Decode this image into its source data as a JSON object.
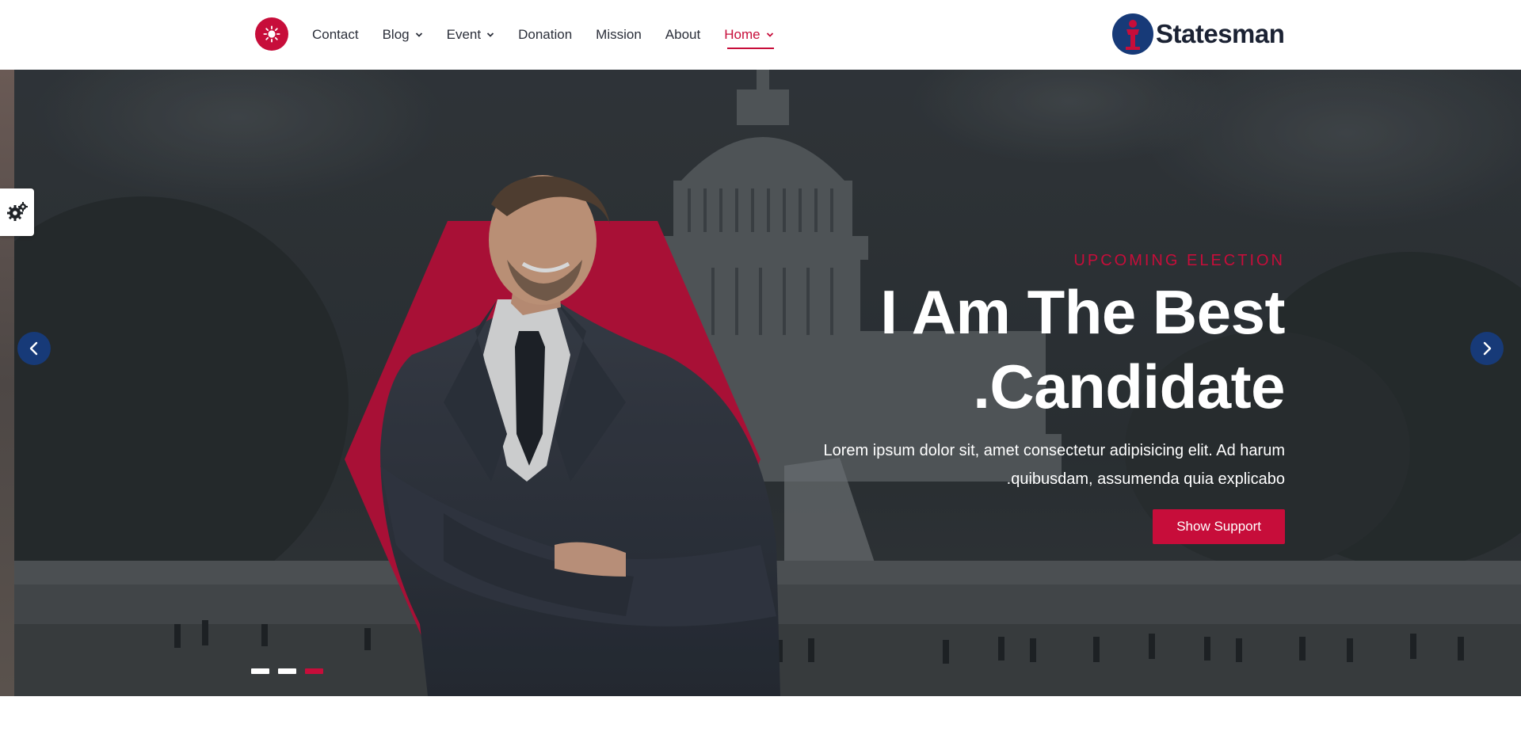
{
  "header": {
    "menu_badge_icon": "sun-burst-icon",
    "nav": [
      {
        "label": "Contact",
        "has_dropdown": false
      },
      {
        "label": "Blog",
        "has_dropdown": true
      },
      {
        "label": "Event",
        "has_dropdown": true
      },
      {
        "label": "Donation",
        "has_dropdown": false
      },
      {
        "label": "Mission",
        "has_dropdown": false
      },
      {
        "label": "About",
        "has_dropdown": false
      },
      {
        "label": "Home",
        "has_dropdown": true,
        "active": true
      }
    ],
    "logo": {
      "text": "Statesman",
      "icon": "podium-speaker-icon"
    }
  },
  "hero": {
    "eyebrow": "UPCOMING ELECTION",
    "headline_line1": "I Am The Best",
    "headline_line2": ".Candidate",
    "desc_line1": "Lorem ipsum dolor sit, amet consectetur adipisicing elit. Ad harum",
    "desc_line2": ".quibusdam, assumenda quia explicabo",
    "cta_label": "Show Support",
    "slides_total": 3,
    "active_slide": 3
  },
  "colors": {
    "accent": "#c70d3a",
    "brand_blue": "#173a78",
    "text_dark": "#2b2f3a",
    "hero_overlay": "#2c3135"
  },
  "icons": {
    "settings": "gears-icon",
    "prev": "chevron-left-icon",
    "next": "chevron-right-icon"
  }
}
